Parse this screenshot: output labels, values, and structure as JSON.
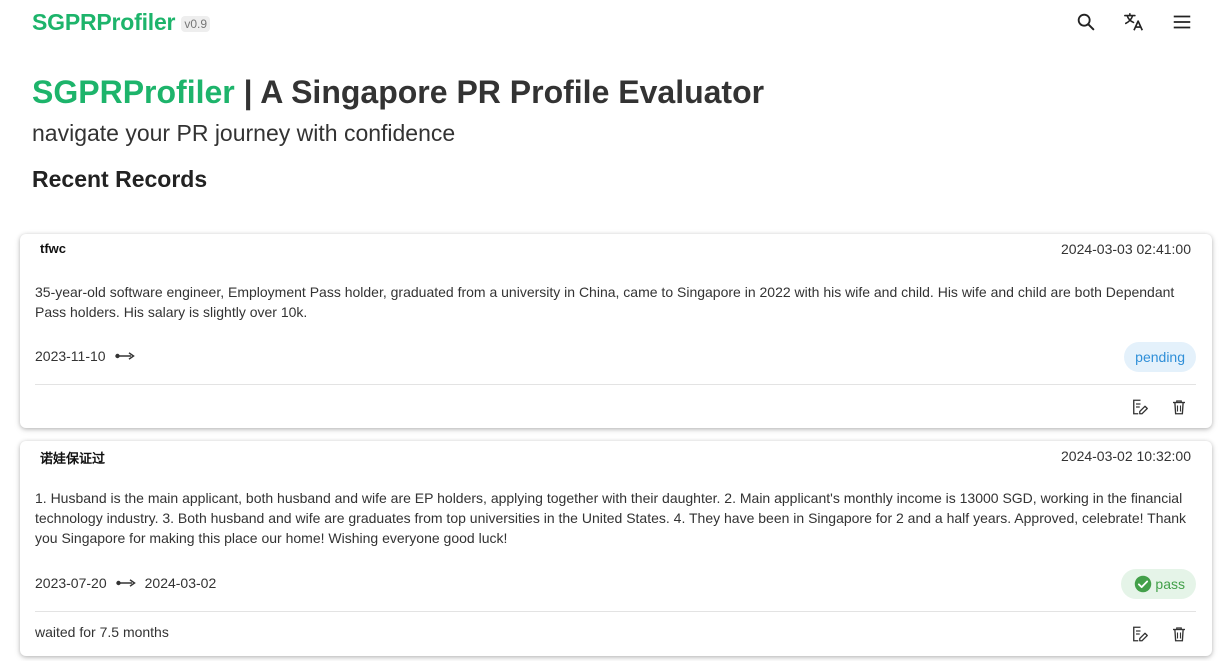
{
  "app": {
    "name": "SGPRProfiler",
    "version": "v0.9"
  },
  "topbar": {
    "icons": [
      "search-icon",
      "translate-icon",
      "menu-icon"
    ]
  },
  "hero": {
    "title_accent": "SGPRProfiler",
    "title_rest": " | A Singapore PR Profile Evaluator",
    "subtitle": "navigate your PR journey with confidence"
  },
  "section": {
    "title": "Recent Records"
  },
  "colors": {
    "brand": "#1db46b",
    "pending_text": "#2f8fd8",
    "pending_bg": "#e4f1fb",
    "pass_text": "#43a04a",
    "pass_bg": "#e5f4e8"
  },
  "records": [
    {
      "title": "tfwc",
      "datetime": "2024-03-03 02:41:00",
      "description": "35-year-old software engineer, Employment Pass holder, graduated from a university in China, came to Singapore in 2022 with his wife and child. His wife and child are both Dependant Pass holders. His salary is slightly over 10k.",
      "start_date": "2023-11-10",
      "end_date": "",
      "status": "pending",
      "status_icon": "",
      "waited": ""
    },
    {
      "title": "诺娃保证过",
      "datetime": "2024-03-02 10:32:00",
      "description": "1. Husband is the main applicant, both husband and wife are EP holders, applying together with their daughter. 2. Main applicant's monthly income is 13000 SGD, working in the financial technology industry. 3. Both husband and wife are graduates from top universities in the United States. 4. They have been in Singapore for 2 and a half years. Approved, celebrate! Thank you Singapore for making this place our home! Wishing everyone good luck!",
      "start_date": "2023-07-20",
      "end_date": "2024-03-02",
      "status": "pass",
      "status_icon": "check-circle-icon",
      "waited": "waited for 7.5 months"
    }
  ]
}
